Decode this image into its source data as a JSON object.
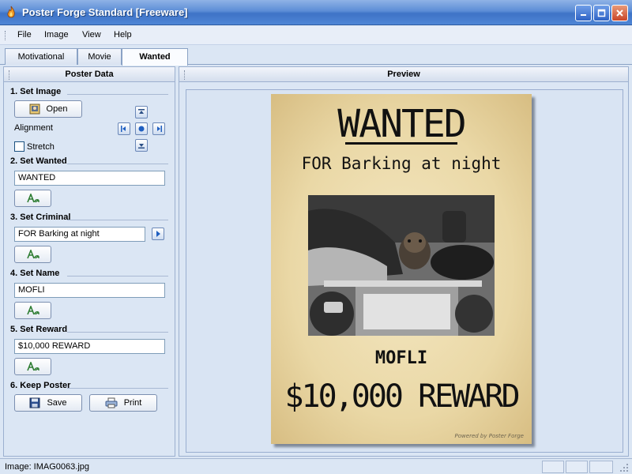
{
  "window": {
    "title": "Poster Forge Standard [Freeware]"
  },
  "menu": {
    "file": "File",
    "image": "Image",
    "view": "View",
    "help": "Help"
  },
  "tabs": [
    {
      "label": "Motivational"
    },
    {
      "label": "Movie"
    },
    {
      "label": "Wanted",
      "active": true
    }
  ],
  "left_panel": {
    "header": "Poster Data",
    "set_image": {
      "title": "1. Set Image",
      "open_label": "Open",
      "alignment_label": "Alignment",
      "stretch_label": "Stretch",
      "stretch_checked": false
    },
    "set_wanted": {
      "title": "2. Set Wanted",
      "value": "WANTED"
    },
    "set_criminal": {
      "title": "3. Set Criminal",
      "value": "FOR Barking at night"
    },
    "set_name": {
      "title": "4. Set Name",
      "value": "MOFLI"
    },
    "set_reward": {
      "title": "5. Set Reward",
      "value": "$10,000 REWARD"
    },
    "keep_poster": {
      "title": "6. Keep Poster",
      "save_label": "Save",
      "print_label": "Print"
    }
  },
  "preview": {
    "header": "Preview",
    "poster": {
      "title": "WANTED",
      "subtitle": "FOR Barking at night",
      "name": "MOFLI",
      "reward": "$10,000 REWARD",
      "powered_by": "Powered by Poster Forge"
    }
  },
  "status": {
    "text": "Image: IMAG0063.jpg"
  },
  "colors": {
    "title_bar": "#4f86d6",
    "panel_bg": "#dbe6f4",
    "poster_paper": "#ead8a6"
  }
}
